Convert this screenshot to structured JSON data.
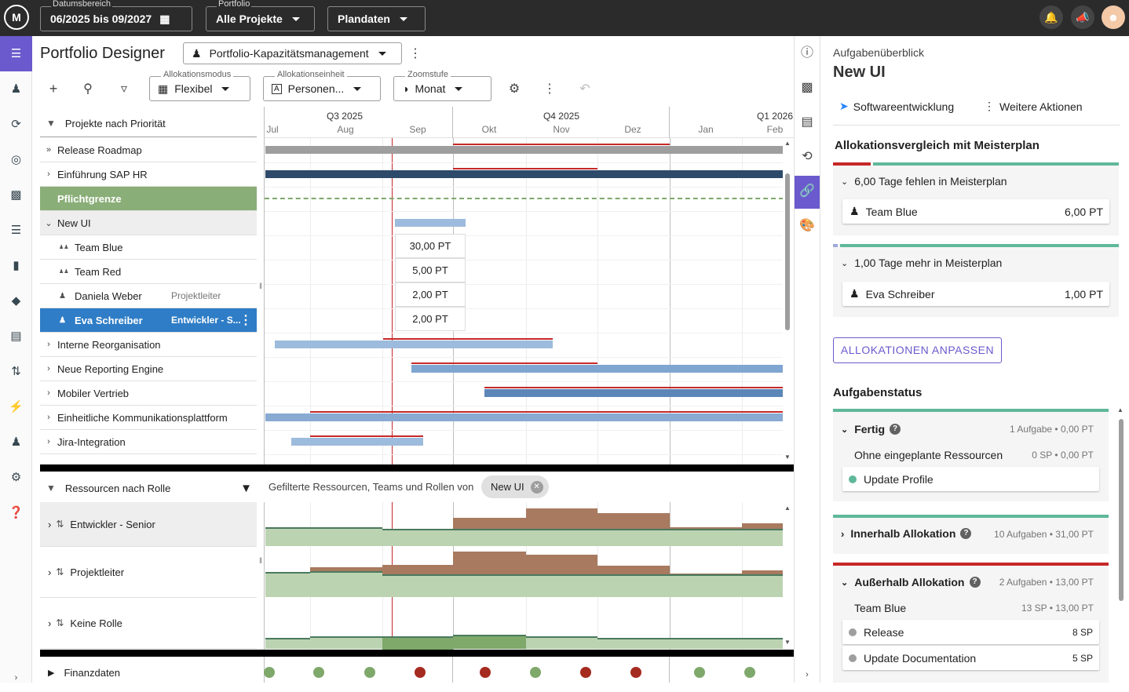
{
  "topbar": {
    "logo_text": "M",
    "date_label": "Datumsbereich",
    "date_value": "06/2025 bis 09/2027",
    "portfolio_label": "Portfolio",
    "portfolio_value": "Alle Projekte",
    "plan_value": "Plandaten",
    "icons": [
      "bell-icon",
      "megaphone-icon",
      "avatar"
    ]
  },
  "header": {
    "title": "Portfolio Designer",
    "view_select": "Portfolio-Kapazitätsmanagement",
    "alloc_mode_label": "Allokationsmodus",
    "alloc_mode_value": "Flexibel",
    "alloc_unit_label": "Allokationseinheit",
    "alloc_unit_value": "Personen...",
    "zoom_label": "Zoomstufe",
    "zoom_value": "Monat"
  },
  "timeline": {
    "quarters": [
      "Q3 2025",
      "Q4 2025",
      "Q1 2026"
    ],
    "months": [
      "Jul",
      "Aug",
      "Sep",
      "Okt",
      "Nov",
      "Dez",
      "Jan",
      "Feb"
    ]
  },
  "projects": {
    "header": "Projekte nach Priorität",
    "rows": [
      {
        "label": "Release Roadmap"
      },
      {
        "label": "Einführung SAP HR"
      },
      {
        "label": "Pflichtgrenze"
      },
      {
        "label": "New UI"
      },
      {
        "label": "Team Blue",
        "value": "30,00 PT"
      },
      {
        "label": "Team Red",
        "value": "5,00 PT"
      },
      {
        "label": "Daniela Weber",
        "role": "Projektleiter",
        "value": "2,00 PT"
      },
      {
        "label": "Eva Schreiber",
        "role": "Entwickler - S...",
        "value": "2,00 PT"
      },
      {
        "label": "Interne Reorganisation"
      },
      {
        "label": "Neue Reporting Engine"
      },
      {
        "label": "Mobiler Vertrieb"
      },
      {
        "label": "Einheitliche Kommunikationsplattform"
      },
      {
        "label": "Jira-Integration"
      }
    ]
  },
  "resources": {
    "header": "Ressourcen nach Rolle",
    "filter_text": "Gefilterte Ressourcen, Teams und Rollen von",
    "chip": "New UI",
    "rows": [
      "Entwickler - Senior",
      "Projektleiter",
      "Keine Rolle"
    ]
  },
  "finance": {
    "label": "Finanzdaten"
  },
  "panel": {
    "overline": "Aufgabenüberblick",
    "title": "New UI",
    "tag": "Softwareentwicklung",
    "more": "Weitere Aktionen",
    "compare_title": "Allokationsvergleich mit Meisterplan",
    "missing_header": "6,00 Tage fehlen in Meisterplan",
    "missing_item": {
      "label": "Team Blue",
      "value": "6,00 PT"
    },
    "extra_header": "1,00 Tage mehr in Meisterplan",
    "extra_item": {
      "label": "Eva Schreiber",
      "value": "1,00 PT"
    },
    "adjust_button": "ALLOKATIONEN ANPASSEN",
    "status_title": "Aufgabenstatus",
    "done": {
      "label": "Fertig",
      "meta": "1 Aufgabe • 0,00 PT",
      "sub_label": "Ohne eingeplante Ressourcen",
      "sub_meta": "0 SP • 0,00 PT",
      "task": "Update Profile"
    },
    "inside": {
      "label": "Innerhalb Allokation",
      "meta": "10 Aufgaben • 31,00 PT"
    },
    "outside": {
      "label": "Außerhalb Allokation",
      "meta": "2 Aufgaben • 13,00 PT",
      "team": "Team Blue",
      "team_meta": "13 SP • 13,00 PT",
      "tasks": [
        {
          "label": "Release",
          "sp": "8 SP"
        },
        {
          "label": "Update Documentation",
          "sp": "5 SP"
        }
      ]
    }
  },
  "colors": {
    "accent": "#6a5acd",
    "green": "#7fa86b",
    "green_bar": "#8aae78",
    "red": "#c62828",
    "blue_bar": "#9dbbdc",
    "navy_bar": "#2e4a6b",
    "brown": "#a87a5f",
    "teal": "#5fb89a"
  },
  "finance_dots": [
    "green",
    "green",
    "green",
    "red",
    "red",
    "green",
    "red",
    "red",
    "green",
    "green"
  ]
}
